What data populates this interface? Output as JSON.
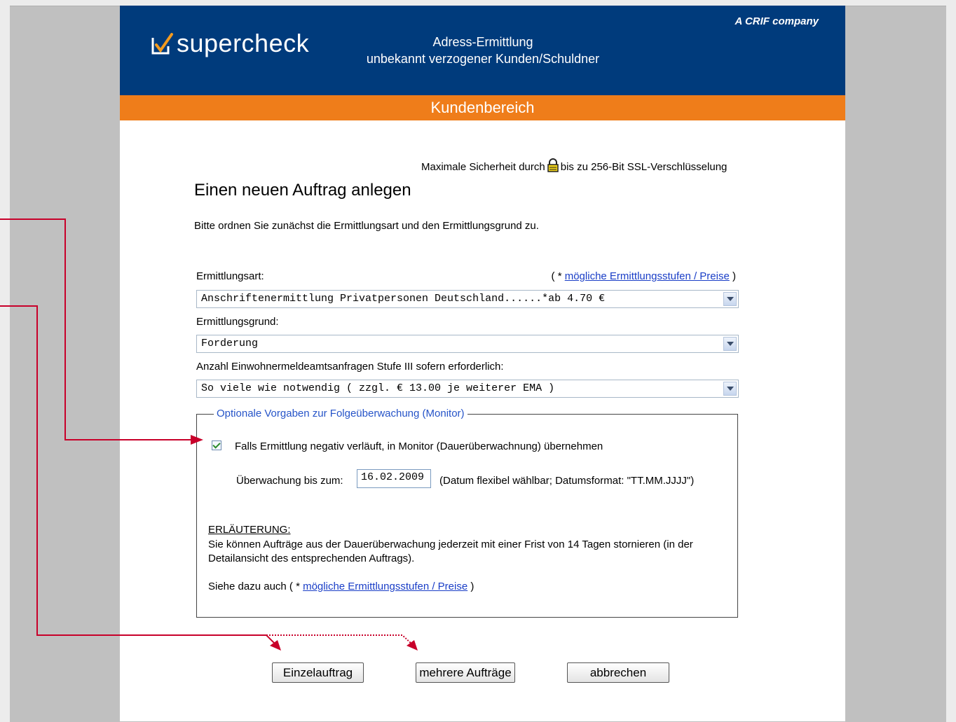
{
  "header": {
    "logo_text": "supercheck",
    "subtitle_line1": "Adress-Ermittlung",
    "subtitle_line2": "unbekannt verzogener Kunden/Schuldner",
    "tagline": "A CRIF company"
  },
  "nav": {
    "section": "Kundenbereich"
  },
  "security": {
    "text_before": "Maximale Sicherheit durch",
    "text_after": "bis zu 256-Bit SSL-Verschlüsselung",
    "icon": "lock-icon"
  },
  "form": {
    "title": "Einen neuen Auftrag anlegen",
    "intro": "Bitte ordnen Sie zunächst die Ermittlungsart und den Ermittlungsgrund zu.",
    "ermittlungsart_label": "Ermittlungsart:",
    "prices_prefix": "( * ",
    "prices_link": "mögliche Ermittlungsstufen / Preise",
    "prices_suffix": " )",
    "ermittlungsart_value": "Anschriftenermittlung Privatpersonen Deutschland......*ab 4.70 €",
    "ermittlungsgrund_label": "Ermittlungsgrund:",
    "ermittlungsgrund_value": "Forderung",
    "anfragen_label": "Anzahl Einwohnermeldeamtsanfragen Stufe III sofern erforderlich:",
    "anfragen_value": "So viele wie notwendig ( zzgl. € 13.00 je weiterer EMA )"
  },
  "monitor": {
    "legend": "Optionale Vorgaben zur Folgeüberwachung (Monitor)",
    "checkbox_checked": true,
    "checkbox_label": "Falls Ermittlung negativ verläuft, in Monitor (Dauerüberwachnung) übernehmen",
    "until_label": "Überwachung bis zum:",
    "until_value": "16.02.2009",
    "date_hint": "(Datum flexibel wählbar; Datumsformat: \"TT.MM.JJJJ\")",
    "explanation_heading": "ERLÄUTERUNG:",
    "explanation_text": "Sie können Aufträge aus der Dauerüberwachung jederzeit mit einer Frist von 14 Tagen stornieren (in der Detailansicht des entsprechenden Auftrags).",
    "see_also_prefix": "Siehe dazu auch ( * ",
    "see_also_link": "mögliche Ermittlungsstufen / Preise",
    "see_also_suffix": " )"
  },
  "buttons": {
    "single": "Einzelauftrag",
    "multiple": "mehrere Aufträge",
    "cancel": "abbrechen"
  },
  "colors": {
    "header_blue": "#003b7c",
    "orange": "#ef7d1a",
    "annotation_red": "#c8002a"
  }
}
